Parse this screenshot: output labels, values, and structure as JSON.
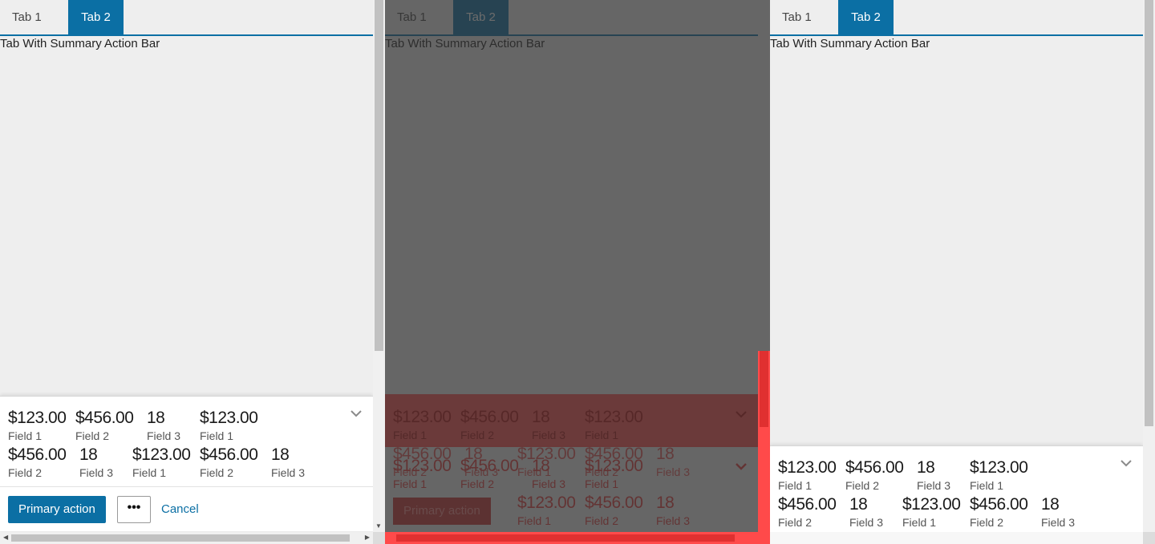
{
  "tabs": [
    {
      "label": "Tab 1"
    },
    {
      "label": "Tab 2"
    }
  ],
  "content_title": "Tab With Summary Action Bar",
  "summary_fields": [
    {
      "value": "$123.00",
      "label": "Field 1"
    },
    {
      "value": "$456.00",
      "label": "Field 2"
    },
    {
      "value": "18",
      "label": "Field 3"
    },
    {
      "value": "$123.00",
      "label": "Field 1"
    },
    {
      "value": "$456.00",
      "label": "Field 2"
    },
    {
      "value": "18",
      "label": "Field 3"
    },
    {
      "value": "$123.00",
      "label": "Field 1"
    },
    {
      "value": "$456.00",
      "label": "Field 2"
    },
    {
      "value": "18",
      "label": "Field 3"
    }
  ],
  "actions": {
    "primary": "Primary action",
    "more": "•••",
    "cancel": "Cancel"
  },
  "icons": {
    "expand": "chevron-down-icon",
    "overflow": "more-icon"
  },
  "colors": {
    "accent": "#0b6fa4",
    "overlay_highlight": "#ff4a4a"
  }
}
